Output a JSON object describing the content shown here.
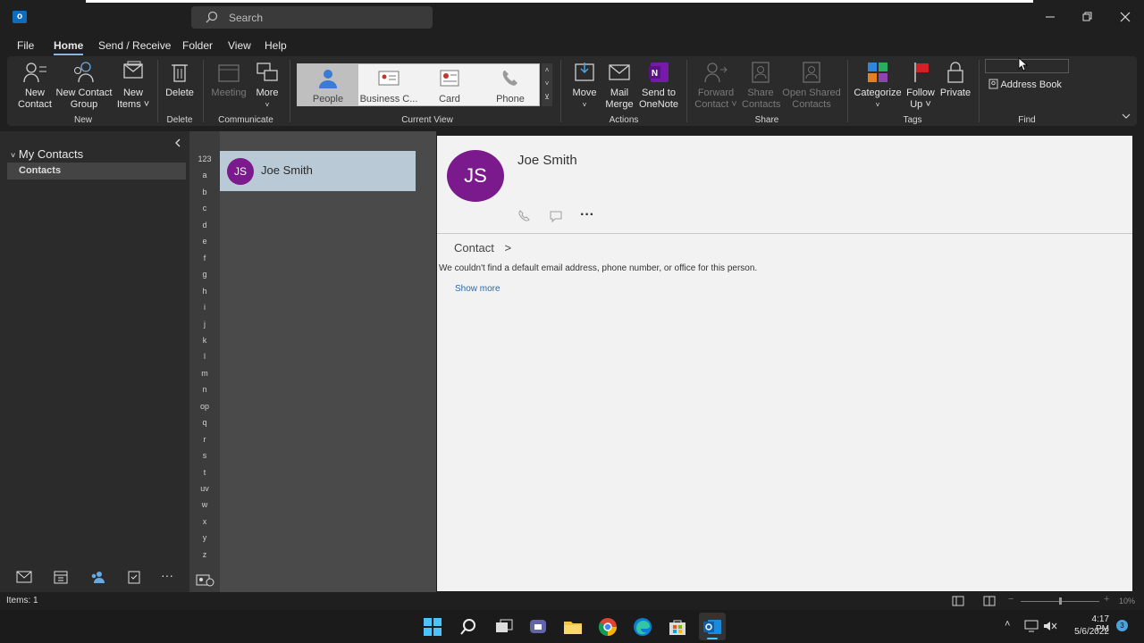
{
  "window": {
    "search_placeholder": "Search"
  },
  "menu": {
    "tabs": [
      "File",
      "Home",
      "Send / Receive",
      "Folder",
      "View",
      "Help"
    ],
    "active": "Home"
  },
  "ribbon": {
    "new_contact": [
      "New",
      "Contact"
    ],
    "new_contact_group": [
      "New Contact",
      "Group"
    ],
    "new_items": [
      "New",
      "Items ˅"
    ],
    "group_new": "New",
    "delete": "Delete",
    "group_delete": "Delete",
    "meeting": "Meeting",
    "more": "More",
    "group_communicate": "Communicate",
    "views": [
      "People",
      "Business C...",
      "Card",
      "Phone"
    ],
    "group_current_view": "Current View",
    "move": "Move",
    "mail_merge": [
      "Mail",
      "Merge"
    ],
    "send_to_onenote": [
      "Send to",
      "OneNote"
    ],
    "group_actions": "Actions",
    "forward_contact": [
      "Forward",
      "Contact ˅"
    ],
    "share_contacts": [
      "Share",
      "Contacts"
    ],
    "open_shared_contacts": [
      "Open Shared",
      "Contacts"
    ],
    "group_share": "Share",
    "categorize": "Categorize",
    "follow_up": [
      "Follow",
      "Up ˅"
    ],
    "private": "Private",
    "group_tags": "Tags",
    "address_book": "Address Book",
    "group_find": "Find"
  },
  "folders": {
    "header": "My Contacts",
    "items": [
      "Contacts"
    ]
  },
  "alpha_index": [
    "123",
    "a",
    "b",
    "c",
    "d",
    "e",
    "f",
    "g",
    "h",
    "i",
    "j",
    "k",
    "l",
    "m",
    "n",
    "op",
    "q",
    "r",
    "s",
    "t",
    "uv",
    "w",
    "x",
    "y",
    "z"
  ],
  "contacts": [
    {
      "initials": "JS",
      "name": "Joe Smith"
    }
  ],
  "reading_pane": {
    "initials": "JS",
    "name": "Joe Smith",
    "section": "Contact",
    "message": "We couldn't find a default email address, phone number, or office for this person.",
    "show_more": "Show more"
  },
  "status": {
    "items": "Items: 1",
    "zoom": "10%"
  },
  "taskbar": {
    "time": "4:17 PM",
    "date": "5/6/2022",
    "notifications": "3"
  },
  "colors": {
    "avatar": "#7a1a8c",
    "selected_card": "#b9c9d6",
    "link": "#2c6aa8"
  }
}
